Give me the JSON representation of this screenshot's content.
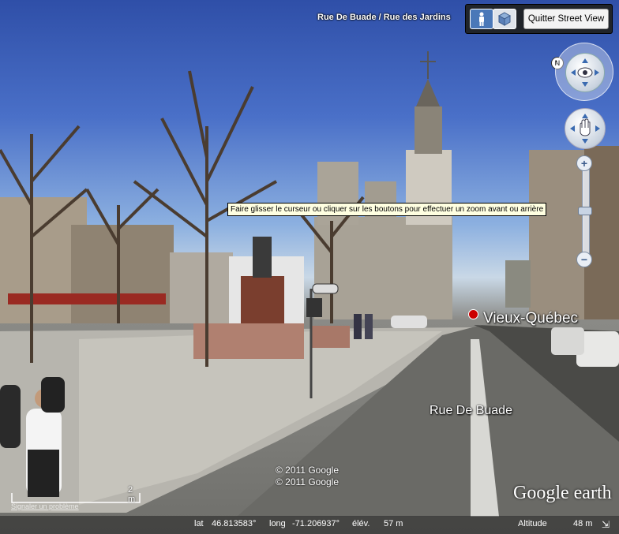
{
  "header": {
    "street_name": "Rue De Buade / Rue des Jardins"
  },
  "toolbar": {
    "quit_label": "Quitter Street View"
  },
  "navigation": {
    "north_label": "N"
  },
  "zoom": {
    "plus": "+",
    "minus": "−",
    "tooltip": "Faire glisser le curseur ou cliquer sur les boutons pour effectuer un zoom avant ou arrière"
  },
  "map_labels": {
    "place": "Vieux-Québec",
    "road": "Rue De Buade"
  },
  "overlay": {
    "copyright_1": "© 2011 Google",
    "copyright_2": "© 2011 Google",
    "logo": "Google earth",
    "scale": "2 m",
    "report": "Signaler un problème"
  },
  "status": {
    "lat_label": "lat",
    "lat_value": "46.813583°",
    "long_label": "long",
    "long_value": "-71.206937°",
    "elev_label": "élév.",
    "elev_value": "57 m",
    "alt_label": "Altitude",
    "alt_value": "48 m"
  },
  "colors": {
    "sky": "#4a70c8",
    "pin": "#cc0000",
    "tooltip_bg": "#ffffe1"
  }
}
